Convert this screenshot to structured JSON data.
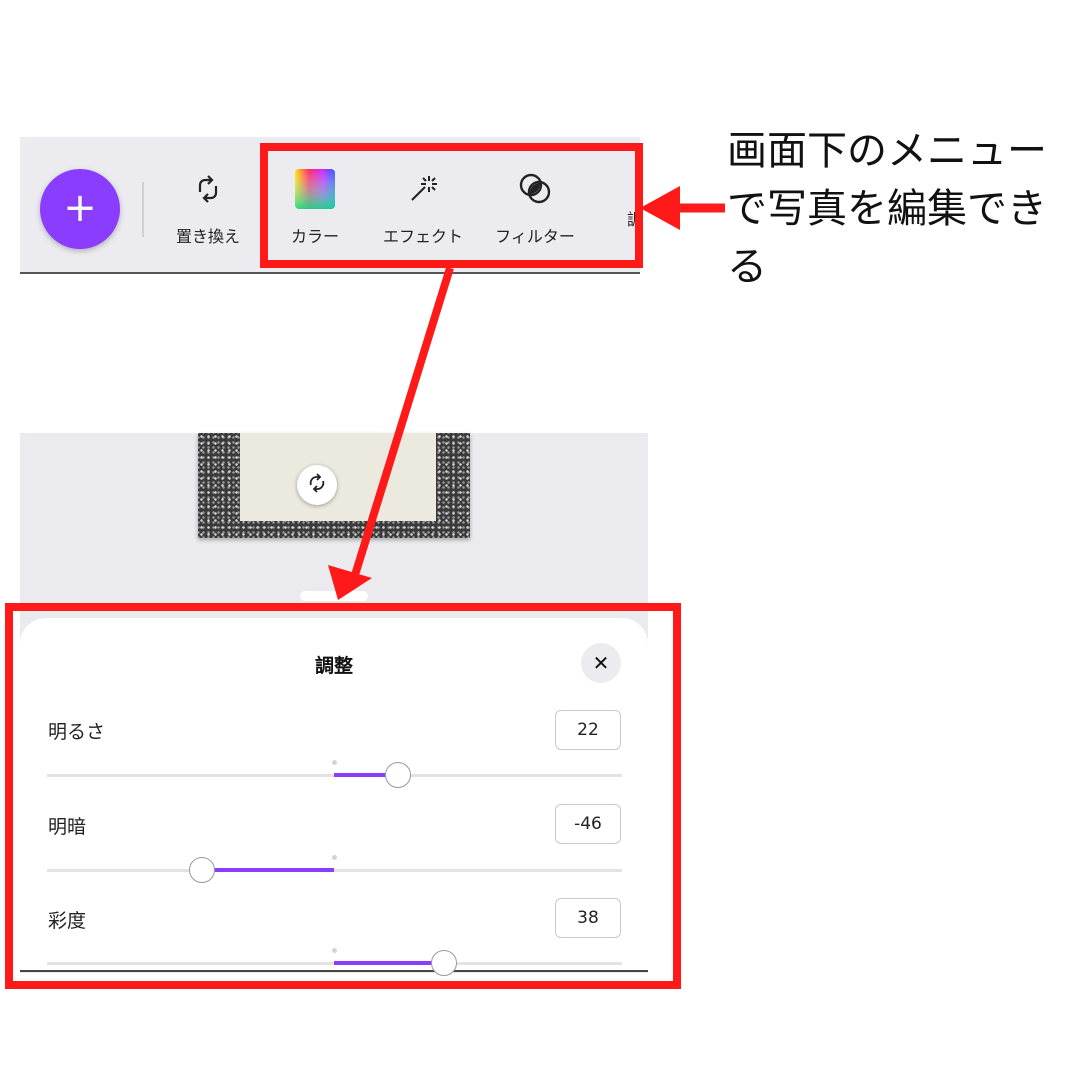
{
  "toolbar": {
    "add_button_symbol": "+",
    "items": [
      {
        "label": "置き換え",
        "icon": "replace-icon"
      },
      {
        "label": "カラー",
        "icon": "color-icon"
      },
      {
        "label": "エフェクト",
        "icon": "effects-icon"
      },
      {
        "label": "フィルター",
        "icon": "filter-icon"
      },
      {
        "label": "調",
        "icon": "adjust-icon"
      }
    ]
  },
  "canvas": {
    "replace_icon": "rotate-icon"
  },
  "adjust_panel": {
    "title": "調整",
    "close_symbol": "✕",
    "sliders": [
      {
        "label": "明るさ",
        "value": "22"
      },
      {
        "label": "明暗",
        "value": "-46"
      },
      {
        "label": "彩度",
        "value": "38"
      }
    ],
    "slider_range": [
      -100,
      100
    ]
  },
  "annotation": {
    "text": "画面下のメニューで写真を編集できる",
    "color": "#ff1a1a"
  },
  "colors": {
    "accent": "#8b3dff",
    "annotation_red": "#ff1a1a"
  }
}
